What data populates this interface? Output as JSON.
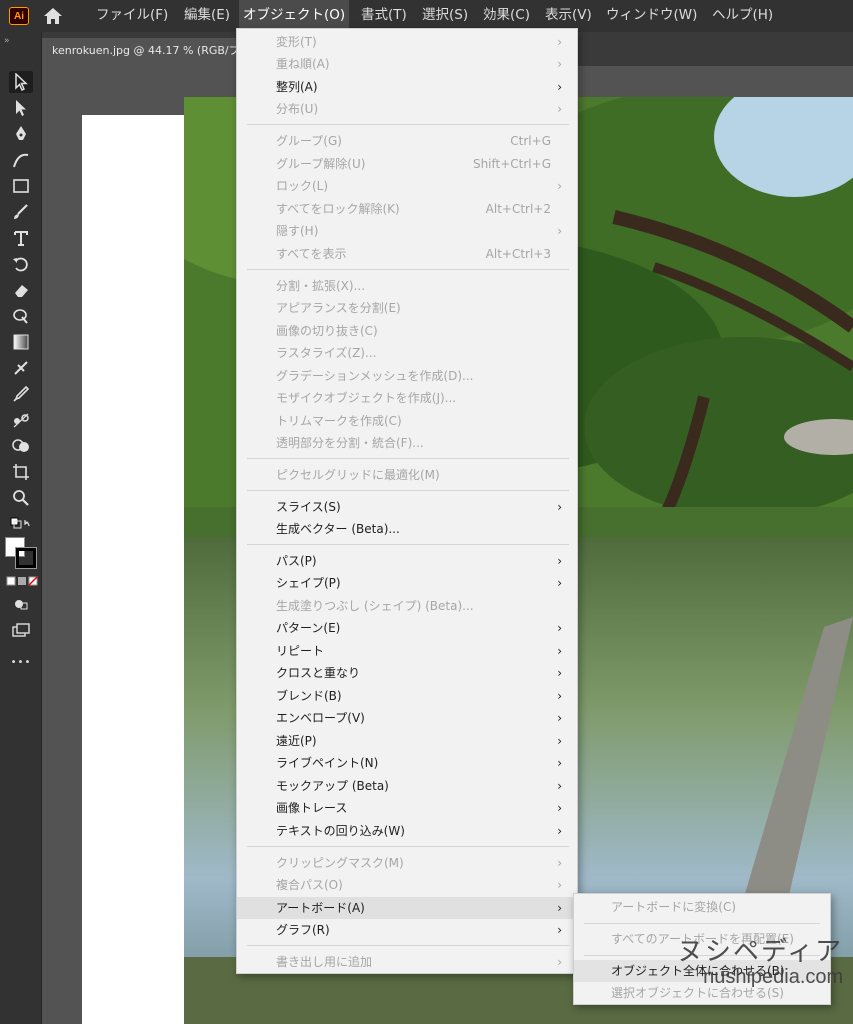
{
  "app": {
    "logo_text": "Ai",
    "brand_color": "#ff9a00"
  },
  "menubar": {
    "items": [
      "ファイル(F)",
      "編集(E)",
      "オブジェクト(O)",
      "書式(T)",
      "選択(S)",
      "効果(C)",
      "表示(V)",
      "ウィンドウ(W)",
      "ヘルプ(H)"
    ],
    "active_index": 2
  },
  "document": {
    "tab_title": "kenrokuen.jpg @ 44.17 % (RGB/プ"
  },
  "tools": {
    "collapse_label": "»",
    "icons": [
      "selection-tool-icon",
      "direct-selection-tool-icon",
      "pen-tool-icon",
      "curvature-tool-icon",
      "rectangle-tool-icon",
      "paintbrush-tool-icon",
      "type-tool-icon",
      "rotate-tool-icon",
      "eraser-tool-icon",
      "warp-tool-icon",
      "gradient-tool-icon",
      "eyedropper-tool-icon",
      "blend-tool-icon",
      "symbol-sprayer-tool-icon",
      "shape-builder-tool-icon",
      "artboard-tool-icon",
      "zoom-tool-icon"
    ],
    "fill_color": "#ffffff",
    "stroke_color": "#000000",
    "more_label": "•••"
  },
  "object_menu": {
    "items": [
      {
        "label": "変形(T)",
        "shortcut": "",
        "submenu": true,
        "disabled": true
      },
      {
        "label": "重ね順(A)",
        "shortcut": "",
        "submenu": true,
        "disabled": true
      },
      {
        "label": "整列(A)",
        "shortcut": "",
        "submenu": true,
        "disabled": false
      },
      {
        "label": "分布(U)",
        "shortcut": "",
        "submenu": true,
        "disabled": true
      },
      {
        "label": "グループ(G)",
        "shortcut": "Ctrl+G",
        "submenu": false,
        "disabled": true
      },
      {
        "label": "グループ解除(U)",
        "shortcut": "Shift+Ctrl+G",
        "submenu": false,
        "disabled": true
      },
      {
        "label": "ロック(L)",
        "shortcut": "",
        "submenu": true,
        "disabled": true
      },
      {
        "label": "すべてをロック解除(K)",
        "shortcut": "Alt+Ctrl+2",
        "submenu": false,
        "disabled": true
      },
      {
        "label": "隠す(H)",
        "shortcut": "",
        "submenu": true,
        "disabled": true
      },
      {
        "label": "すべてを表示",
        "shortcut": "Alt+Ctrl+3",
        "submenu": false,
        "disabled": true
      },
      {
        "label": "分割・拡張(X)...",
        "shortcut": "",
        "submenu": false,
        "disabled": true
      },
      {
        "label": "アピアランスを分割(E)",
        "shortcut": "",
        "submenu": false,
        "disabled": true
      },
      {
        "label": "画像の切り抜き(C)",
        "shortcut": "",
        "submenu": false,
        "disabled": true
      },
      {
        "label": "ラスタライズ(Z)...",
        "shortcut": "",
        "submenu": false,
        "disabled": true
      },
      {
        "label": "グラデーションメッシュを作成(D)...",
        "shortcut": "",
        "submenu": false,
        "disabled": true
      },
      {
        "label": "モザイクオブジェクトを作成(J)...",
        "shortcut": "",
        "submenu": false,
        "disabled": true
      },
      {
        "label": "トリムマークを作成(C)",
        "shortcut": "",
        "submenu": false,
        "disabled": true
      },
      {
        "label": "透明部分を分割・統合(F)...",
        "shortcut": "",
        "submenu": false,
        "disabled": true
      },
      {
        "label": "ピクセルグリッドに最適化(M)",
        "shortcut": "",
        "submenu": false,
        "disabled": true
      },
      {
        "label": "スライス(S)",
        "shortcut": "",
        "submenu": true,
        "disabled": false
      },
      {
        "label": "生成ベクター (Beta)...",
        "shortcut": "",
        "submenu": false,
        "disabled": false
      },
      {
        "label": "パス(P)",
        "shortcut": "",
        "submenu": true,
        "disabled": false
      },
      {
        "label": "シェイプ(P)",
        "shortcut": "",
        "submenu": true,
        "disabled": false
      },
      {
        "label": "生成塗りつぶし (シェイプ) (Beta)...",
        "shortcut": "",
        "submenu": false,
        "disabled": true
      },
      {
        "label": "パターン(E)",
        "shortcut": "",
        "submenu": true,
        "disabled": false
      },
      {
        "label": "リピート",
        "shortcut": "",
        "submenu": true,
        "disabled": false
      },
      {
        "label": "クロスと重なり",
        "shortcut": "",
        "submenu": true,
        "disabled": false
      },
      {
        "label": "ブレンド(B)",
        "shortcut": "",
        "submenu": true,
        "disabled": false
      },
      {
        "label": "エンベロープ(V)",
        "shortcut": "",
        "submenu": true,
        "disabled": false
      },
      {
        "label": "遠近(P)",
        "shortcut": "",
        "submenu": true,
        "disabled": false
      },
      {
        "label": "ライブペイント(N)",
        "shortcut": "",
        "submenu": true,
        "disabled": false
      },
      {
        "label": "モックアップ (Beta)",
        "shortcut": "",
        "submenu": true,
        "disabled": false
      },
      {
        "label": "画像トレース",
        "shortcut": "",
        "submenu": true,
        "disabled": false
      },
      {
        "label": "テキストの回り込み(W)",
        "shortcut": "",
        "submenu": true,
        "disabled": false
      },
      {
        "label": "クリッピングマスク(M)",
        "shortcut": "",
        "submenu": true,
        "disabled": true
      },
      {
        "label": "複合パス(O)",
        "shortcut": "",
        "submenu": true,
        "disabled": true
      },
      {
        "label": "アートボード(A)",
        "shortcut": "",
        "submenu": true,
        "disabled": false,
        "highlighted": true
      },
      {
        "label": "グラフ(R)",
        "shortcut": "",
        "submenu": true,
        "disabled": false
      },
      {
        "label": "書き出し用に追加",
        "shortcut": "",
        "submenu": true,
        "disabled": true
      }
    ],
    "arrow_glyph": "›"
  },
  "artboard_submenu": {
    "items": [
      {
        "label": "アートボードに変換(C)",
        "disabled": true
      },
      {
        "label": "すべてのアートボードを再配置(E)",
        "disabled": true
      },
      {
        "label": "オブジェクト全体に合わせる(B)",
        "disabled": false,
        "highlighted": true
      },
      {
        "label": "選択オブジェクトに合わせる(S)",
        "disabled": true
      }
    ]
  },
  "watermark": {
    "line1": "ヌシペディア",
    "line2": "nushipedia.com"
  }
}
